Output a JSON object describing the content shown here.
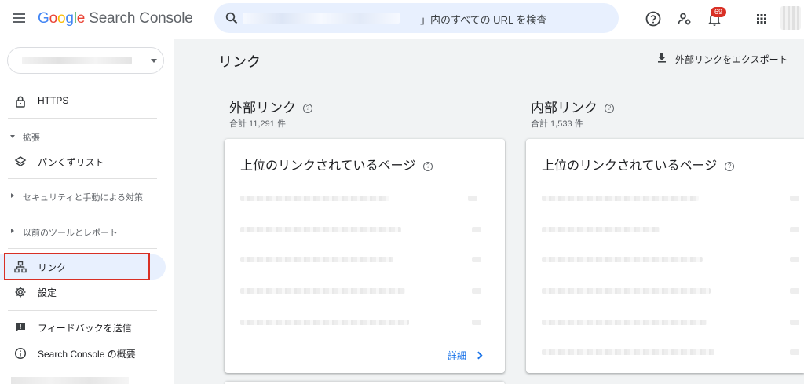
{
  "header": {
    "menu_icon": "hamburger-icon",
    "logo": {
      "letters": [
        "G",
        "o",
        "o",
        "g",
        "l",
        "e"
      ],
      "product": "Search Console"
    },
    "search": {
      "prefix_redacted": true,
      "text": "」内のすべての URL を検査",
      "icon": "search-icon"
    },
    "icons": [
      "help-icon",
      "manage-users-icon",
      "notifications-icon",
      "apps-grid-icon"
    ],
    "notification_count": "69"
  },
  "sidebar": {
    "property_selector": {
      "redacted": true
    },
    "items": [
      {
        "id": "https",
        "label": "HTTPS",
        "icon": "lock-icon"
      },
      {
        "id": "breadcrumbs",
        "label": "パンくずリスト",
        "icon": "layers-icon"
      },
      {
        "id": "links",
        "label": "リンク",
        "icon": "sitemap-icon",
        "active": true
      },
      {
        "id": "settings",
        "label": "設定",
        "icon": "gear-icon"
      },
      {
        "id": "feedback",
        "label": "フィードバックを送信",
        "icon": "feedback-icon"
      },
      {
        "id": "about",
        "label": "Search Console の概要",
        "icon": "info-icon"
      }
    ],
    "sections": {
      "enhancements": "拡張",
      "security": "セキュリティと手動による対策",
      "legacy": "以前のツールとレポート"
    }
  },
  "main": {
    "title": "リンク",
    "export_label": "外部リンクをエクスポート",
    "external": {
      "title": "外部リンク",
      "subtitle": "合計 11,291 件",
      "card_title": "上位のリンクされているページ",
      "detail_label": "詳細"
    },
    "internal": {
      "title": "内部リンク",
      "subtitle": "合計 1,533 件",
      "card_title": "上位のリンクされているページ"
    }
  },
  "colors": {
    "accent": "#1a73e8",
    "active_bg": "#e8f0fe",
    "highlight_border": "#d93025",
    "badge": "#d93025",
    "main_bg": "#f1f3f4"
  }
}
